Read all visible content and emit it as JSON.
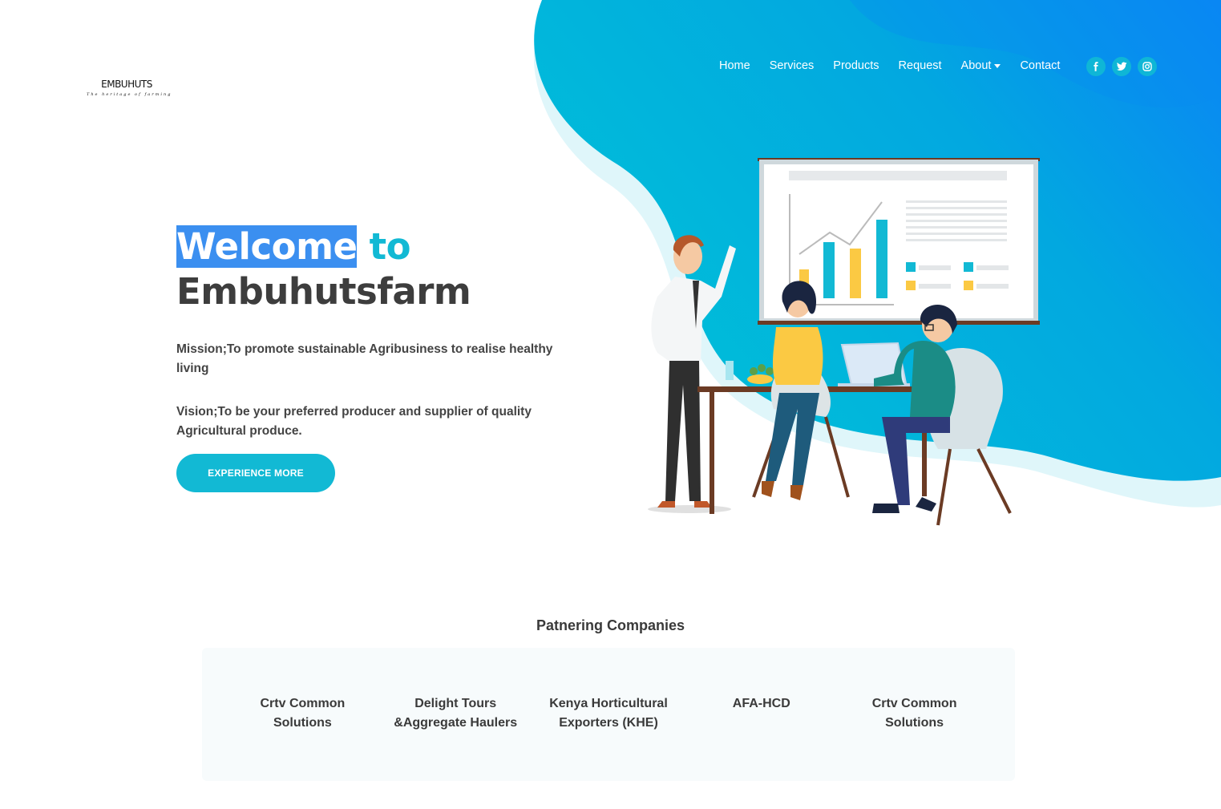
{
  "brand": {
    "logo_text": "EMBUHUTS",
    "logo_tagline": "The heritage of farming"
  },
  "nav": {
    "items": [
      {
        "label": "Home"
      },
      {
        "label": "Services"
      },
      {
        "label": "Products"
      },
      {
        "label": "Request"
      },
      {
        "label": "About"
      },
      {
        "label": "Contact"
      }
    ],
    "socials": [
      "facebook-icon",
      "twitter-icon",
      "instagram-icon"
    ]
  },
  "hero": {
    "title_highlight": "Welcome",
    "title_rest": " to",
    "title_line2": "Embuhutsfarm",
    "mission": "Mission;To promote sustainable Agribusiness to realise healthy living",
    "vision": "Vision;To be your preferred producer and supplier of quality Agricultural produce.",
    "cta_label": "EXPERIENCE MORE"
  },
  "partners": {
    "title": "Patnering Companies",
    "items": [
      {
        "name": "Crtv Common Solutions"
      },
      {
        "name": "Delight Tours &Aggregate Haulers"
      },
      {
        "name": "Kenya Horticultural Exporters (KHE)"
      },
      {
        "name": "AFA-HCD"
      },
      {
        "name": "Crtv Common Solutions"
      }
    ]
  },
  "colors": {
    "accent": "#12b9d4",
    "highlight": "#3b8ff0",
    "gradient_start": "#00c2d6",
    "gradient_end": "#0a84f5"
  }
}
